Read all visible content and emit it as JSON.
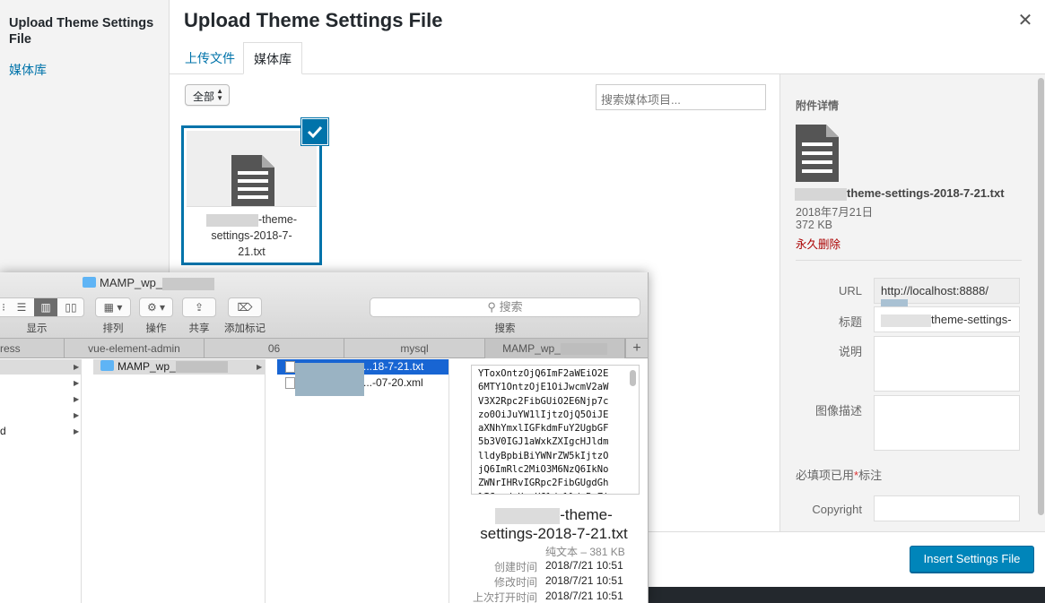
{
  "menu": {
    "title": "Upload Theme Settings File",
    "media_library_link": "媒体库"
  },
  "frame": {
    "title": "Upload Theme Settings File",
    "close_icon": "close-icon",
    "close_glyph": "✕"
  },
  "tabs": {
    "upload": "上传文件",
    "library": "媒体库"
  },
  "toolbar": {
    "filter_value": "全部",
    "search_placeholder": "搜索媒体项目..."
  },
  "attachment": {
    "filename_line1": "-theme-",
    "filename_line2": "settings-2018-7-",
    "filename_line3": "21.txt",
    "checked": true
  },
  "details": {
    "heading": "附件详情",
    "filename": "theme-settings-2018-7-21.txt",
    "date": "2018年7月21日",
    "size": "372 KB",
    "delete_link": "永久删除",
    "url_label": "URL",
    "url_value": "http://localhost:8888/",
    "title_label": "标题",
    "title_value": "theme-settings-",
    "caption_label": "说明",
    "description_label": "图像描述",
    "required_text": "必填项已用",
    "required_star": "*",
    "required_suffix": "标注",
    "copyright_label": "Copyright"
  },
  "footer": {
    "insert_button": "Insert Settings File"
  },
  "finder": {
    "title": "MAMP_wp_",
    "toolbar": {
      "view_label": "显示",
      "arrange_label": "排列",
      "action_label": "操作",
      "share_label": "共享",
      "tags_label": "添加标记",
      "search_placeholder": "搜索",
      "search_label": "搜索"
    },
    "tabs": [
      "ress",
      "vue-element-admin",
      "06",
      "mysql",
      "MAMP_wp_"
    ],
    "plus": "+",
    "col1_rows": [
      "",
      "",
      "",
      "",
      "d"
    ],
    "col2_rows": [
      "MAMP_wp_"
    ],
    "col3_rows": [
      "...18-7-21.txt",
      "...-07-20.xml"
    ],
    "preview_text": "YToxOntzOjQ6ImF2aWEiO2E\n6MTY1OntzOjE1OiJwcmV2aW\nV3X2Rpc2FibGUiO2E6Njp7c\nzo0OiJuYW1lIjtzOjQ5OiJE\naXNhYmxlIGFkdmFuY2UgbGF\n5b3V0IGJ1aWxkZXIgcHJldm\nlldyBpbiBiYWNrZW5kIjtzO\njQ6ImRlc2MiO3M6NzQ6IkNo\nZWNrIHRvIGRpc2FibGUgdGh\nlIGxpdmUgcHJldmlldyBvZi\nB5b3VyIGFkdmFuY2VkIGxhe",
    "preview_name_line1": "-theme-",
    "preview_name_line2": "settings-2018-7-21.txt",
    "preview_kind": "纯文本 – 381 KB",
    "created_label": "创建时间",
    "created_value": "2018/7/21 10:51",
    "modified_label": "修改时间",
    "modified_value": "2018/7/21 10:51",
    "opened_label": "上次打开时间",
    "opened_value": "2018/7/21 10:51"
  }
}
